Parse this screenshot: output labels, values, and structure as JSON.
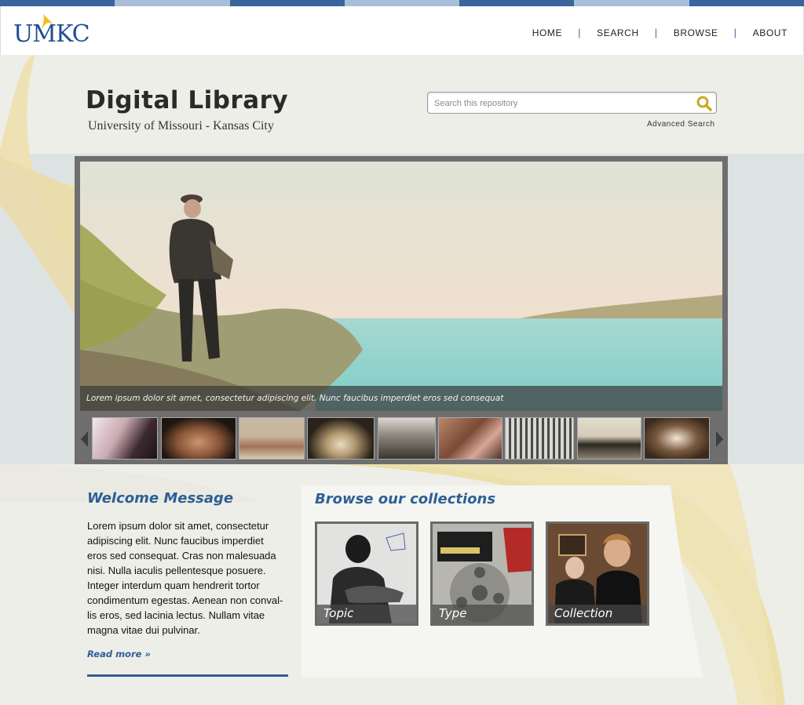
{
  "header": {
    "logo_text": "UMKC",
    "nav": [
      {
        "label": "HOME"
      },
      {
        "label": "SEARCH"
      },
      {
        "label": "BROWSE"
      },
      {
        "label": "ABOUT"
      }
    ],
    "separator": "|"
  },
  "site": {
    "title": "Digital Library",
    "subtitle": "University of Missouri - Kansas City"
  },
  "search": {
    "placeholder": "Search this repository",
    "advanced_label": "Advanced Search"
  },
  "slider": {
    "caption": "Lorem ipsum dolor sit amet, consectetur adipiscing elit. Nunc faucibus imperdiet eros sed consequat"
  },
  "welcome": {
    "title": "Welcome Message",
    "body": "Lorem ipsum dolor sit amet, consectetur adipiscing elit. Nunc faucibus imperdiet eros sed consequat. Cras non malesuada nisi. Nulla iaculis pellentesque posuere. Integer interdum quam hendrerit tortor condimentum egestas. Aenean non conval-lis eros, sed lacinia lectus. Nullam vitae magna vitae dui pulvinar.",
    "read_more": "Read more »"
  },
  "collections": {
    "title": "Browse our collections",
    "items": [
      {
        "label": "Topic"
      },
      {
        "label": "Type"
      },
      {
        "label": "Collection"
      }
    ]
  },
  "colors": {
    "brand_blue": "#2e5f96",
    "accent_gold": "#e8d9a0",
    "background": "#eeeee8"
  }
}
